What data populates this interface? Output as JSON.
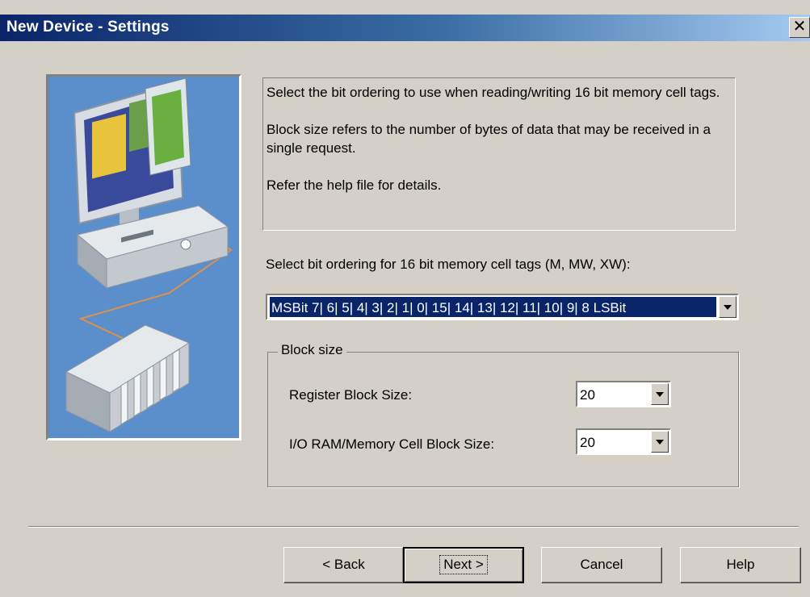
{
  "window": {
    "title": "New Device - Settings",
    "close_glyph": "✕"
  },
  "info": {
    "line1": "Select the bit ordering to use when reading/writing 16 bit memory cell tags.",
    "line2": "Block size refers to the number of bytes of data that may be received in a single request.",
    "line3": "Refer the help file for details."
  },
  "bit_ordering": {
    "label": "Select bit ordering for 16 bit memory cell tags (M, MW, XW):",
    "value": "MSBit 7| 6| 5| 4| 3| 2| 1| 0| 15| 14| 13| 12| 11| 10| 9| 8 LSBit"
  },
  "block_size": {
    "legend": "Block size",
    "register_label": "Register Block Size:",
    "register_value": "20",
    "io_label": "I/O RAM/Memory Cell Block Size:",
    "io_value": "20"
  },
  "buttons": {
    "back": "< Back",
    "next": "Next >",
    "cancel": "Cancel",
    "help": "Help"
  },
  "colors": {
    "title_gradient_start": "#0a246a",
    "title_gradient_end": "#a6caf0",
    "face": "#d4d0c8",
    "selection": "#0a246a",
    "illustration_bg": "#5b8fcb"
  }
}
